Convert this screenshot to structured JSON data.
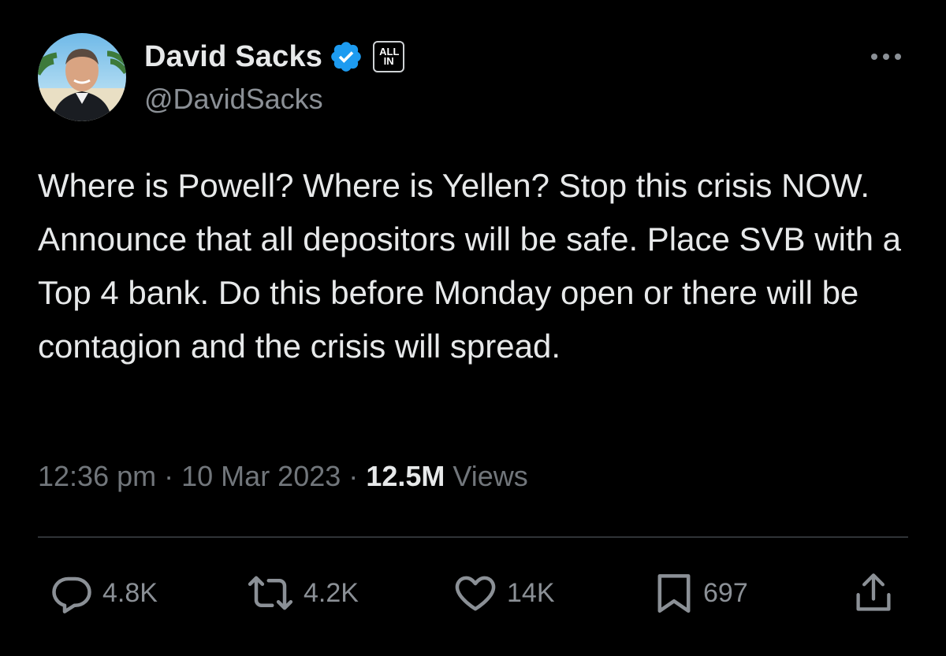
{
  "author": {
    "display_name": "David Sacks",
    "handle": "@DavidSacks",
    "affiliate_badge": "ALL IN",
    "verified_color": "#1d9bf0"
  },
  "tweet": {
    "text": "Where is Powell? Where is Yellen? Stop this crisis NOW. Announce that all depositors will be safe. Place SVB with a Top 4 bank. Do this before Monday open or there will be contagion and the crisis will spread.",
    "time": "12:36 pm",
    "date": "10 Mar 2023",
    "separator": "·",
    "views_count": "12.5M",
    "views_label": "Views"
  },
  "actions": {
    "replies": "4.8K",
    "reposts": "4.2K",
    "likes": "14K",
    "bookmarks": "697"
  },
  "icons": {
    "reply": "reply-icon",
    "repost": "repost-icon",
    "like": "heart-icon",
    "bookmark": "bookmark-icon",
    "share": "share-icon",
    "more": "more-options-icon",
    "verified": "verified-badge-icon"
  },
  "colors": {
    "background": "#000000",
    "text_primary": "#e7e9ea",
    "text_secondary": "#71767b",
    "divider": "#2f3336",
    "verified": "#1d9bf0"
  }
}
